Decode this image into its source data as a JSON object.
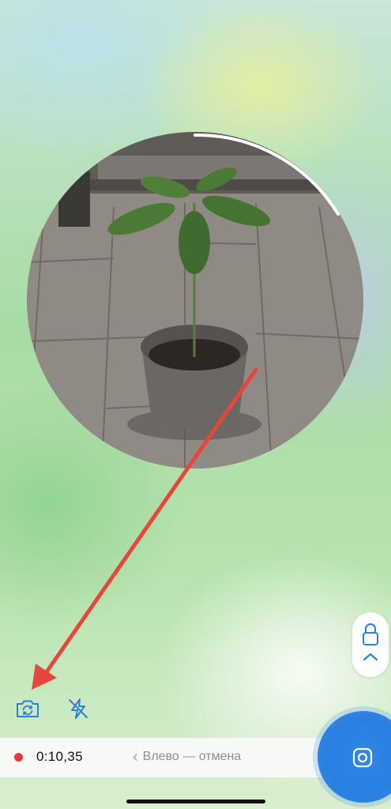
{
  "recording": {
    "timer": "0:10,35",
    "cancel_hint": "Влево — отмена",
    "indicator_color": "#e53935"
  },
  "controls": {
    "switch_camera_icon": "camera-switch-icon",
    "flash_icon": "flash-off-icon",
    "lock_icon": "lock-icon",
    "lock_chevron_icon": "chevron-up-icon",
    "record_icon": "video-message-icon"
  },
  "colors": {
    "accent": "#2a7fe0",
    "annotation_arrow": "#e8453c"
  }
}
